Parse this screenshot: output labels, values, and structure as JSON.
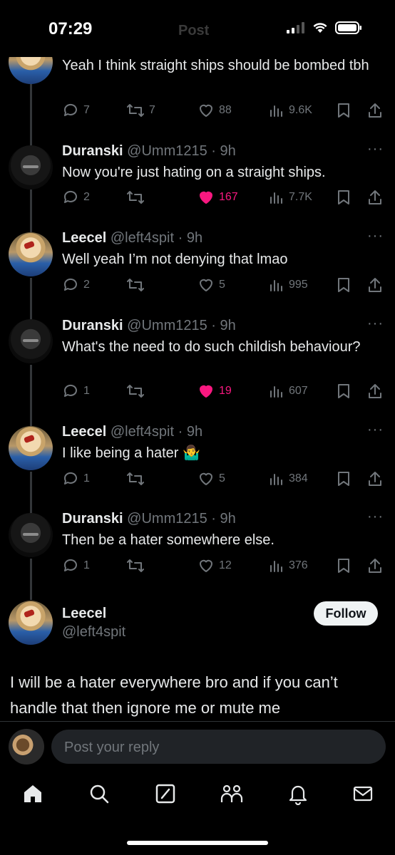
{
  "status_bar": {
    "time": "07:29",
    "ghost_title": "Post"
  },
  "tweets": [
    {
      "name": "",
      "handle": "",
      "time": "",
      "text": "Yeah I think straight ships should be bombed tbh",
      "replies": "7",
      "reposts": "7",
      "likes": "88",
      "views": "9.6K",
      "liked": false
    },
    {
      "name": "Duranski",
      "handle": "@Umm1215",
      "time": "· 9h",
      "text": "Now you're just hating on a straight ships.",
      "replies": "2",
      "reposts": "",
      "likes": "167",
      "views": "7.7K",
      "liked": true
    },
    {
      "name": "Leecel",
      "handle": "@left4spit",
      "time": "· 9h",
      "text": "Well yeah I’m not denying that lmao",
      "replies": "2",
      "reposts": "",
      "likes": "5",
      "views": "995",
      "liked": false
    },
    {
      "name": "Duranski",
      "handle": "@Umm1215",
      "time": "· 9h",
      "text": "What's the need to do such childish behaviour?",
      "replies": "1",
      "reposts": "",
      "likes": "19",
      "views": "607",
      "liked": true
    },
    {
      "name": "Leecel",
      "handle": "@left4spit",
      "time": "· 9h",
      "text": "I like being a hater 🤷‍♂️",
      "replies": "1",
      "reposts": "",
      "likes": "5",
      "views": "384",
      "liked": false
    },
    {
      "name": "Duranski",
      "handle": "@Umm1215",
      "time": "· 9h",
      "text": "Then be a hater somewhere else.",
      "replies": "1",
      "reposts": "",
      "likes": "12",
      "views": "376",
      "liked": false
    }
  ],
  "main_post": {
    "name": "Leecel",
    "handle": "@left4spit",
    "follow_label": "Follow",
    "text": "I will be a hater everywhere bro and if you can’t handle that then ignore me or mute me"
  },
  "reply": {
    "placeholder": "Post your reply"
  },
  "colors": {
    "like_active": "#f91880",
    "muted": "#71767b",
    "background": "#000000",
    "text": "#e7e9ea"
  },
  "tabbar": {
    "icons": [
      "home-icon",
      "search-icon",
      "grok-icon",
      "communities-icon",
      "notifications-icon",
      "messages-icon"
    ]
  }
}
